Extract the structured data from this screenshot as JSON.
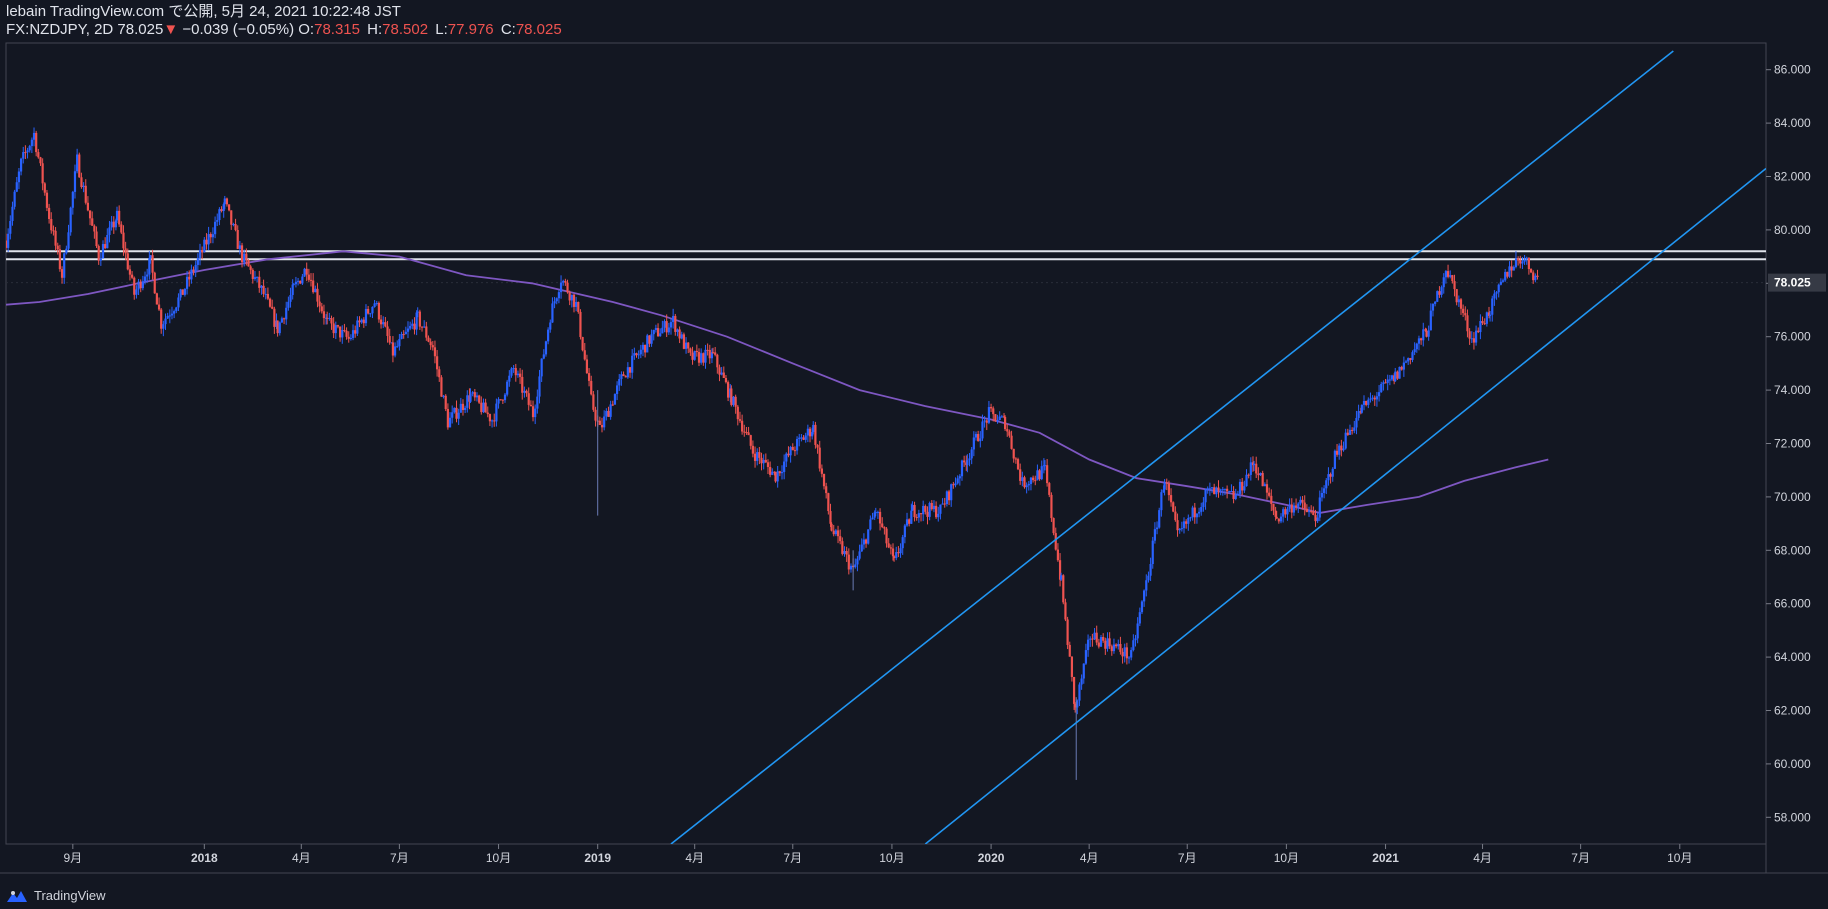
{
  "header": {
    "line1": "lebain TradingView.com で公開, 5月 24, 2021 10:22:48 JST",
    "symbol": "FX:NZDJPY, 2D",
    "last": "78.025",
    "arrow": "▼",
    "change": "−0.039 (−0.05%)",
    "o_label": "O:",
    "o_val": "78.315",
    "h_label": "H:",
    "h_val": "78.502",
    "l_label": "L:",
    "l_val": "77.976",
    "c_label": "C:",
    "c_val": "78.025"
  },
  "brand": {
    "name": "TradingView",
    "icon": "tradingview-logo-icon"
  },
  "colors": {
    "background": "#131722",
    "up": "#2962ff",
    "up_wick": "#1e88e5",
    "down": "#ef5350",
    "ma": "#7e57c2",
    "channel": "#2196f3",
    "hline": "#e0e3eb",
    "price_tag": "#363a45",
    "axis_text": "#d1d4dc",
    "grid": "#2a2e39"
  },
  "chart_data": {
    "type": "candlestick",
    "symbol": "FX:NZDJPY",
    "timeframe": "2D",
    "x_range": [
      "2017-07-01",
      "2021-12-20"
    ],
    "ylim": [
      57,
      87
    ],
    "y_ticks": [
      "58.000",
      "60.000",
      "62.000",
      "64.000",
      "66.000",
      "68.000",
      "70.000",
      "72.000",
      "74.000",
      "76.000",
      "78.000",
      "80.000",
      "82.000",
      "84.000",
      "86.000"
    ],
    "last_price_label": "78.025",
    "x_ticks": [
      {
        "label": "9月",
        "date": "2017-09-01"
      },
      {
        "label": "2018",
        "date": "2018-01-01"
      },
      {
        "label": "4月",
        "date": "2018-04-01"
      },
      {
        "label": "7月",
        "date": "2018-07-01"
      },
      {
        "label": "10月",
        "date": "2018-10-01"
      },
      {
        "label": "2019",
        "date": "2019-01-01"
      },
      {
        "label": "4月",
        "date": "2019-04-01"
      },
      {
        "label": "7月",
        "date": "2019-07-01"
      },
      {
        "label": "10月",
        "date": "2019-10-01"
      },
      {
        "label": "2020",
        "date": "2020-01-01"
      },
      {
        "label": "4月",
        "date": "2020-04-01"
      },
      {
        "label": "7月",
        "date": "2020-07-01"
      },
      {
        "label": "10月",
        "date": "2020-10-01"
      },
      {
        "label": "2021",
        "date": "2021-01-01"
      },
      {
        "label": "4月",
        "date": "2021-04-01"
      },
      {
        "label": "7月",
        "date": "2021-07-01"
      },
      {
        "label": "10月",
        "date": "2021-10-01"
      }
    ],
    "price_path": [
      [
        "2017-07-01",
        79.6
      ],
      [
        "2017-07-15",
        82.5
      ],
      [
        "2017-07-27",
        83.6
      ],
      [
        "2017-08-10",
        80.5
      ],
      [
        "2017-08-22",
        78.3
      ],
      [
        "2017-09-05",
        82.6
      ],
      [
        "2017-09-25",
        79.0
      ],
      [
        "2017-10-12",
        80.5
      ],
      [
        "2017-10-28",
        77.6
      ],
      [
        "2017-11-12",
        78.8
      ],
      [
        "2017-11-22",
        76.5
      ],
      [
        "2017-12-10",
        77.5
      ],
      [
        "2017-12-30",
        79.2
      ],
      [
        "2018-01-20",
        81.0
      ],
      [
        "2018-02-05",
        79.0
      ],
      [
        "2018-02-25",
        77.6
      ],
      [
        "2018-03-10",
        76.3
      ],
      [
        "2018-03-25",
        77.8
      ],
      [
        "2018-04-06",
        78.6
      ],
      [
        "2018-04-25",
        76.5
      ],
      [
        "2018-05-15",
        75.9
      ],
      [
        "2018-06-08",
        77.3
      ],
      [
        "2018-06-25",
        75.4
      ],
      [
        "2018-07-18",
        76.7
      ],
      [
        "2018-08-01",
        75.6
      ],
      [
        "2018-08-15",
        72.8
      ],
      [
        "2018-09-05",
        73.8
      ],
      [
        "2018-09-25",
        72.9
      ],
      [
        "2018-10-15",
        74.8
      ],
      [
        "2018-11-02",
        73.1
      ],
      [
        "2018-11-18",
        76.8
      ],
      [
        "2018-11-28",
        78.2
      ],
      [
        "2018-12-12",
        77.2
      ],
      [
        "2018-12-26",
        73.6
      ],
      [
        "2019-01-03",
        72.5
      ],
      [
        "2019-01-25",
        74.6
      ],
      [
        "2019-02-20",
        76.0
      ],
      [
        "2019-03-12",
        76.6
      ],
      [
        "2019-03-28",
        75.2
      ],
      [
        "2019-04-18",
        75.3
      ],
      [
        "2019-05-05",
        73.7
      ],
      [
        "2019-05-25",
        71.7
      ],
      [
        "2019-06-15",
        70.8
      ],
      [
        "2019-07-01",
        71.8
      ],
      [
        "2019-07-20",
        72.6
      ],
      [
        "2019-08-06",
        68.8
      ],
      [
        "2019-08-26",
        67.2
      ],
      [
        "2019-09-16",
        69.5
      ],
      [
        "2019-10-03",
        67.5
      ],
      [
        "2019-10-20",
        69.5
      ],
      [
        "2019-11-15",
        69.5
      ],
      [
        "2019-12-10",
        71.5
      ],
      [
        "2019-12-30",
        73.1
      ],
      [
        "2020-01-14",
        72.8
      ],
      [
        "2020-01-30",
        70.5
      ],
      [
        "2020-02-20",
        71.0
      ],
      [
        "2020-03-06",
        66.8
      ],
      [
        "2020-03-19",
        62.0
      ],
      [
        "2020-04-02",
        64.8
      ],
      [
        "2020-04-20",
        64.5
      ],
      [
        "2020-05-10",
        64.0
      ],
      [
        "2020-05-26",
        67.2
      ],
      [
        "2020-06-10",
        70.7
      ],
      [
        "2020-06-22",
        68.5
      ],
      [
        "2020-07-20",
        70.2
      ],
      [
        "2020-08-15",
        70.0
      ],
      [
        "2020-09-01",
        71.3
      ],
      [
        "2020-09-22",
        69.2
      ],
      [
        "2020-10-10",
        69.8
      ],
      [
        "2020-10-28",
        69.2
      ],
      [
        "2020-11-15",
        71.5
      ],
      [
        "2020-12-10",
        73.3
      ],
      [
        "2021-01-10",
        74.5
      ],
      [
        "2021-02-08",
        76.2
      ],
      [
        "2021-02-26",
        78.6
      ],
      [
        "2021-03-10",
        77.3
      ],
      [
        "2021-03-22",
        75.9
      ],
      [
        "2021-04-08",
        77.0
      ],
      [
        "2021-04-26",
        78.6
      ],
      [
        "2021-05-08",
        79.0
      ],
      [
        "2021-05-24",
        78.025
      ]
    ],
    "moving_average": [
      [
        "2017-07-01",
        77.2
      ],
      [
        "2017-08-01",
        77.3
      ],
      [
        "2017-09-15",
        77.6
      ],
      [
        "2017-11-01",
        78.0
      ],
      [
        "2018-01-01",
        78.5
      ],
      [
        "2018-03-01",
        78.9
      ],
      [
        "2018-05-10",
        79.2
      ],
      [
        "2018-07-01",
        79.0
      ],
      [
        "2018-09-01",
        78.3
      ],
      [
        "2018-11-01",
        78.0
      ],
      [
        "2019-01-15",
        77.3
      ],
      [
        "2019-03-01",
        76.8
      ],
      [
        "2019-05-01",
        76.0
      ],
      [
        "2019-07-01",
        75.0
      ],
      [
        "2019-09-01",
        74.0
      ],
      [
        "2019-11-01",
        73.4
      ],
      [
        "2020-01-01",
        72.9
      ],
      [
        "2020-02-15",
        72.4
      ],
      [
        "2020-04-01",
        71.4
      ],
      [
        "2020-05-15",
        70.7
      ],
      [
        "2020-07-01",
        70.4
      ],
      [
        "2020-08-15",
        70.1
      ],
      [
        "2020-10-01",
        69.7
      ],
      [
        "2020-11-01",
        69.4
      ],
      [
        "2020-12-15",
        69.7
      ],
      [
        "2021-02-01",
        70.0
      ],
      [
        "2021-03-15",
        70.6
      ],
      [
        "2021-05-01",
        71.1
      ],
      [
        "2021-06-01",
        71.4
      ]
    ],
    "horizontal_lines": [
      79.2,
      78.9
    ],
    "channel_lines": [
      [
        [
          "2019-03-10",
          57.0
        ],
        [
          "2021-09-25",
          86.7
        ]
      ],
      [
        [
          "2019-11-01",
          57.0
        ],
        [
          "2021-12-20",
          82.3
        ]
      ]
    ]
  }
}
